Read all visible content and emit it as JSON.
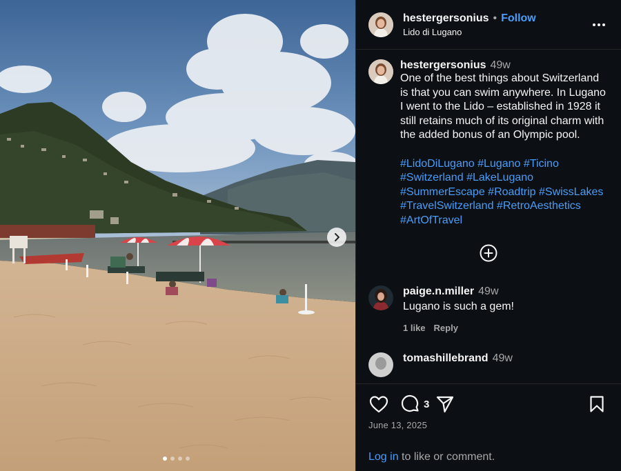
{
  "post": {
    "author": "hestergersonius",
    "separator": "•",
    "follow_label": "Follow",
    "location": "Lido di Lugano",
    "more_icon": "more-horizontal-icon",
    "photo": {
      "next_icon": "chevron-right-icon",
      "slide_count": 4,
      "active_slide": 1
    }
  },
  "caption": {
    "author": "hestergersonius",
    "time": "49w",
    "text": "One of the best things about Switzerland is that you can swim anywhere. In Lugano I went to the Lido – established in 1928 it still retains much of its original charm with the added bonus of an Olympic pool.",
    "hashtags": [
      "#LidoDiLugano",
      "#Lugano",
      "#Ticino",
      "#Switzerland",
      "#LakeLugano",
      "#SummerEscape",
      "#Roadtrip",
      "#SwissLakes",
      "#TravelSwitzerland",
      "#RetroAesthetics",
      "#ArtOfTravel"
    ]
  },
  "load_more_icon": "plus-circle-icon",
  "comments": [
    {
      "author": "paige.n.miller",
      "time": "49w",
      "text": "Lugano is such a gem!",
      "likes_label": "1 like",
      "reply_label": "Reply"
    },
    {
      "author": "tomashillebrand",
      "time": "49w"
    }
  ],
  "actions": {
    "like_icon": "heart-icon",
    "comment_icon": "comment-icon",
    "comment_count": "3",
    "share_icon": "paper-plane-icon",
    "save_icon": "bookmark-icon",
    "date": "June 13, 2025",
    "login_label": "Log in",
    "login_suffix": " to like or comment."
  },
  "colors": {
    "panel_bg": "#0c1014",
    "link_blue": "#4a9df8",
    "muted_text": "#a8a8a8",
    "divider": "#262626"
  }
}
